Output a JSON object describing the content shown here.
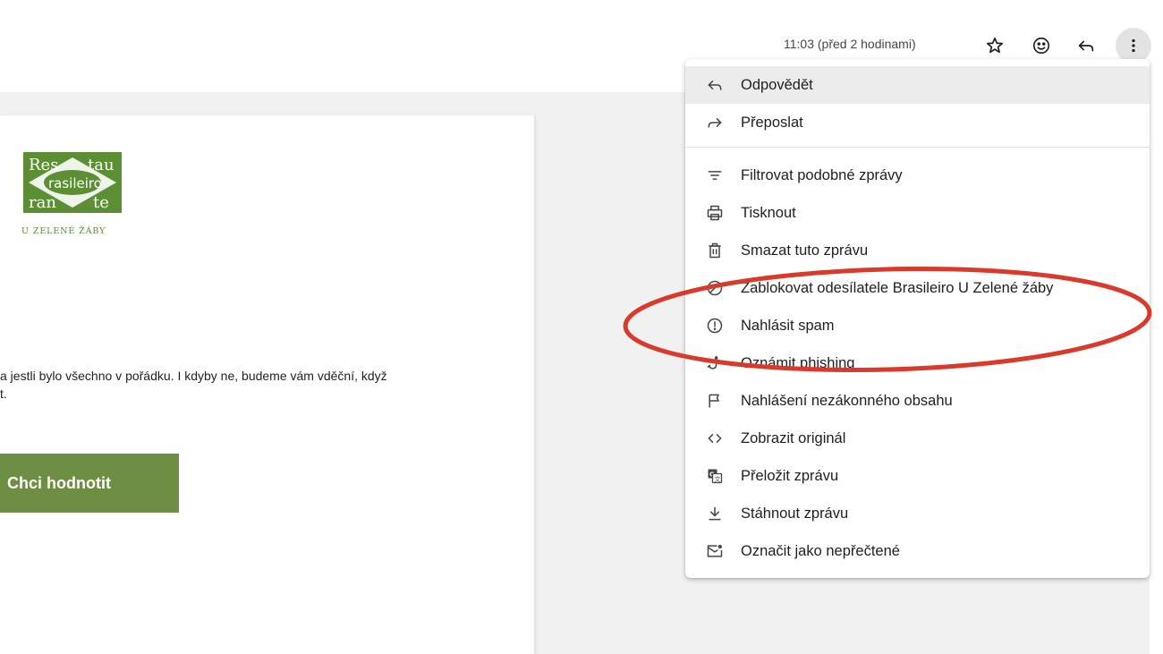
{
  "email": {
    "logo_caption": "U ZELENÉ ŽÁBY",
    "body_lines": [
      "a jestli bylo všechno v pořádku. I kdyby ne, budeme vám vděční, když",
      "t."
    ],
    "cta_label": "Chci hodnotit"
  },
  "header": {
    "timestamp": "11:03 (před 2 hodinami)",
    "icons": [
      "star-icon",
      "emoji-icon",
      "reply-icon",
      "more-vert-icon"
    ]
  },
  "menu": {
    "items": [
      {
        "label": "Odpovědět",
        "icon": "reply-icon"
      },
      {
        "label": "Přeposlat",
        "icon": "forward-icon"
      },
      {
        "label": "Filtrovat podobné zprávy",
        "icon": "filter-icon"
      },
      {
        "label": "Tisknout",
        "icon": "print-icon"
      },
      {
        "label": "Smazat tuto zprávu",
        "icon": "trash-icon"
      },
      {
        "label": "Zablokovat odesílatele Brasileiro U Zelené žáby",
        "icon": "block-icon"
      },
      {
        "label": "Nahlásit spam",
        "icon": "spam-icon"
      },
      {
        "label": "Oznámit phishing",
        "icon": "phishing-icon"
      },
      {
        "label": "Nahlášení nezákonného obsahu",
        "icon": "flag-icon"
      },
      {
        "label": "Zobrazit originál",
        "icon": "code-icon"
      },
      {
        "label": "Přeložit zprávu",
        "icon": "translate-icon"
      },
      {
        "label": "Stáhnout zprávu",
        "icon": "download-icon"
      },
      {
        "label": "Označit jako nepřečtené",
        "icon": "mark-unread-icon"
      }
    ]
  },
  "colors": {
    "brand_green": "#6e8f43",
    "annotation_red": "#d93a2b",
    "hover_bg": "#ececec"
  }
}
